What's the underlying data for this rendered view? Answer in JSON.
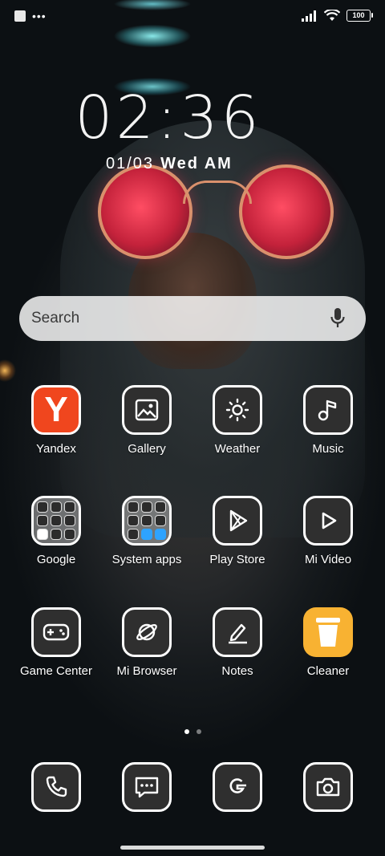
{
  "status_bar": {
    "battery": "100",
    "icons": [
      "notification-square-icon",
      "more-dots-icon",
      "signal-icon",
      "wifi-icon",
      "battery-icon"
    ]
  },
  "clock": {
    "time": "02:36",
    "date": "01/03",
    "weekday_ampm": "Wed AM"
  },
  "search": {
    "placeholder": "Search",
    "icon": "mic-icon"
  },
  "apps": {
    "yandex": {
      "label": "Yandex",
      "icon_text": "Y"
    },
    "gallery": {
      "label": "Gallery"
    },
    "weather": {
      "label": "Weather"
    },
    "music": {
      "label": "Music"
    },
    "google": {
      "label": "Google"
    },
    "system_apps": {
      "label": "System apps"
    },
    "play_store": {
      "label": "Play Store"
    },
    "mi_video": {
      "label": "Mi Video"
    },
    "game_center": {
      "label": "Game Center"
    },
    "mi_browser": {
      "label": "Mi Browser"
    },
    "notes": {
      "label": "Notes"
    },
    "cleaner": {
      "label": "Cleaner"
    }
  },
  "dock": [
    "phone-icon",
    "messages-icon",
    "google-g-icon",
    "camera-icon"
  ],
  "pages": {
    "count": 2,
    "active": 1
  },
  "colors": {
    "yandex": "#f0461e",
    "cleaner": "#f8b232",
    "search_bg": "#f0f0f0"
  }
}
